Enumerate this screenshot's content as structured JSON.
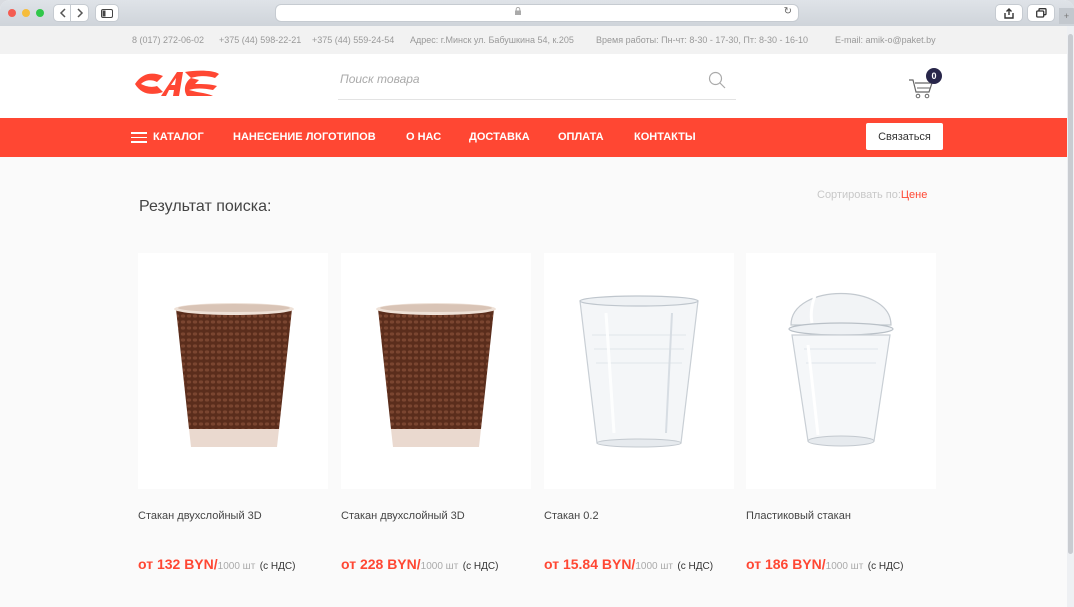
{
  "browser": {
    "reload_glyph": "↻",
    "lock_glyph": "🔒"
  },
  "infobar": {
    "phone1": "8 (017) 272-06-02",
    "phone2": "+375 (44) 598-22-21",
    "phone3": "+375 (44) 559-24-54",
    "address": "Адрес: г.Минск ул. Бабушкина 54, к.205",
    "hours": "Время работы: Пн-чт: 8-30 - 17-30, Пт: 8-30 - 16-10",
    "email": "E-mail: amik-o@paket.by"
  },
  "header": {
    "search_placeholder": "Поиск товара",
    "cart_count": "0"
  },
  "nav": {
    "catalog": "КАТАЛОГ",
    "logo_printing": "НАНЕСЕНИЕ ЛОГОТИПОВ",
    "about": "О НАС",
    "delivery": "ДОСТАВКА",
    "payment": "ОПЛАТА",
    "contacts": "КОНТАКТЫ",
    "contact_button": "Связаться"
  },
  "main": {
    "title": "Результат поиска:",
    "sort_label": "Сортировать по:",
    "sort_value": "Цене"
  },
  "products": [
    {
      "title": "Стакан двухслойный 3D",
      "price": "от 132 BYN/",
      "unit": "1000 шт",
      "vat": "(с НДС)",
      "image": "brown-paper-cup"
    },
    {
      "title": "Стакан двухслойный 3D",
      "price": "от 228 BYN/",
      "unit": "1000 шт",
      "vat": "(с НДС)",
      "image": "brown-paper-cup"
    },
    {
      "title": "Стакан 0.2",
      "price": "от 15.84 BYN/",
      "unit": "1000 шт",
      "vat": "(с НДС)",
      "image": "clear-plastic-cup"
    },
    {
      "title": "Пластиковый стакан",
      "price": "от 186 BYN/",
      "unit": "1000 шт",
      "vat": "(с НДС)",
      "image": "clear-cup-with-dome-lid"
    }
  ],
  "colors": {
    "accent": "#ff4733",
    "badge": "#28264a"
  }
}
